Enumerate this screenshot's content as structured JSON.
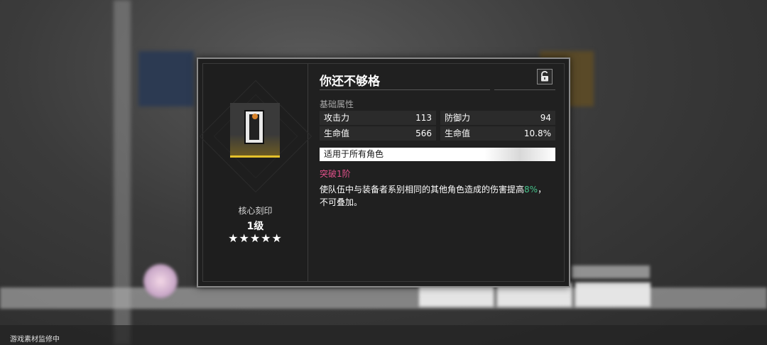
{
  "item": {
    "name": "你还不够格",
    "type": "核心刻印",
    "level": "1级",
    "stars": "★★★★★",
    "star_count": 5,
    "locked": false
  },
  "stats": {
    "section_label": "基础属性",
    "rows": [
      {
        "name": "攻击力",
        "value": "113"
      },
      {
        "name": "防御力",
        "value": "94"
      },
      {
        "name": "生命值",
        "value": "566"
      },
      {
        "name": "生命值",
        "value": "10.8%"
      }
    ]
  },
  "applies_to": "适用于所有角色",
  "breakthrough": "突破1阶",
  "description": {
    "prefix": "使队伍中与装备者系别相同的其他角色造成的伤害提高",
    "highlight": "8%",
    "suffix": "，",
    "line2": "不可叠加。"
  },
  "watermark": "游戏素材监修中",
  "colors": {
    "star_border": "#e5c12c",
    "breakthrough": "#e2518b",
    "highlight": "#45c28a"
  },
  "icons": {
    "lock": "unlock-icon"
  }
}
